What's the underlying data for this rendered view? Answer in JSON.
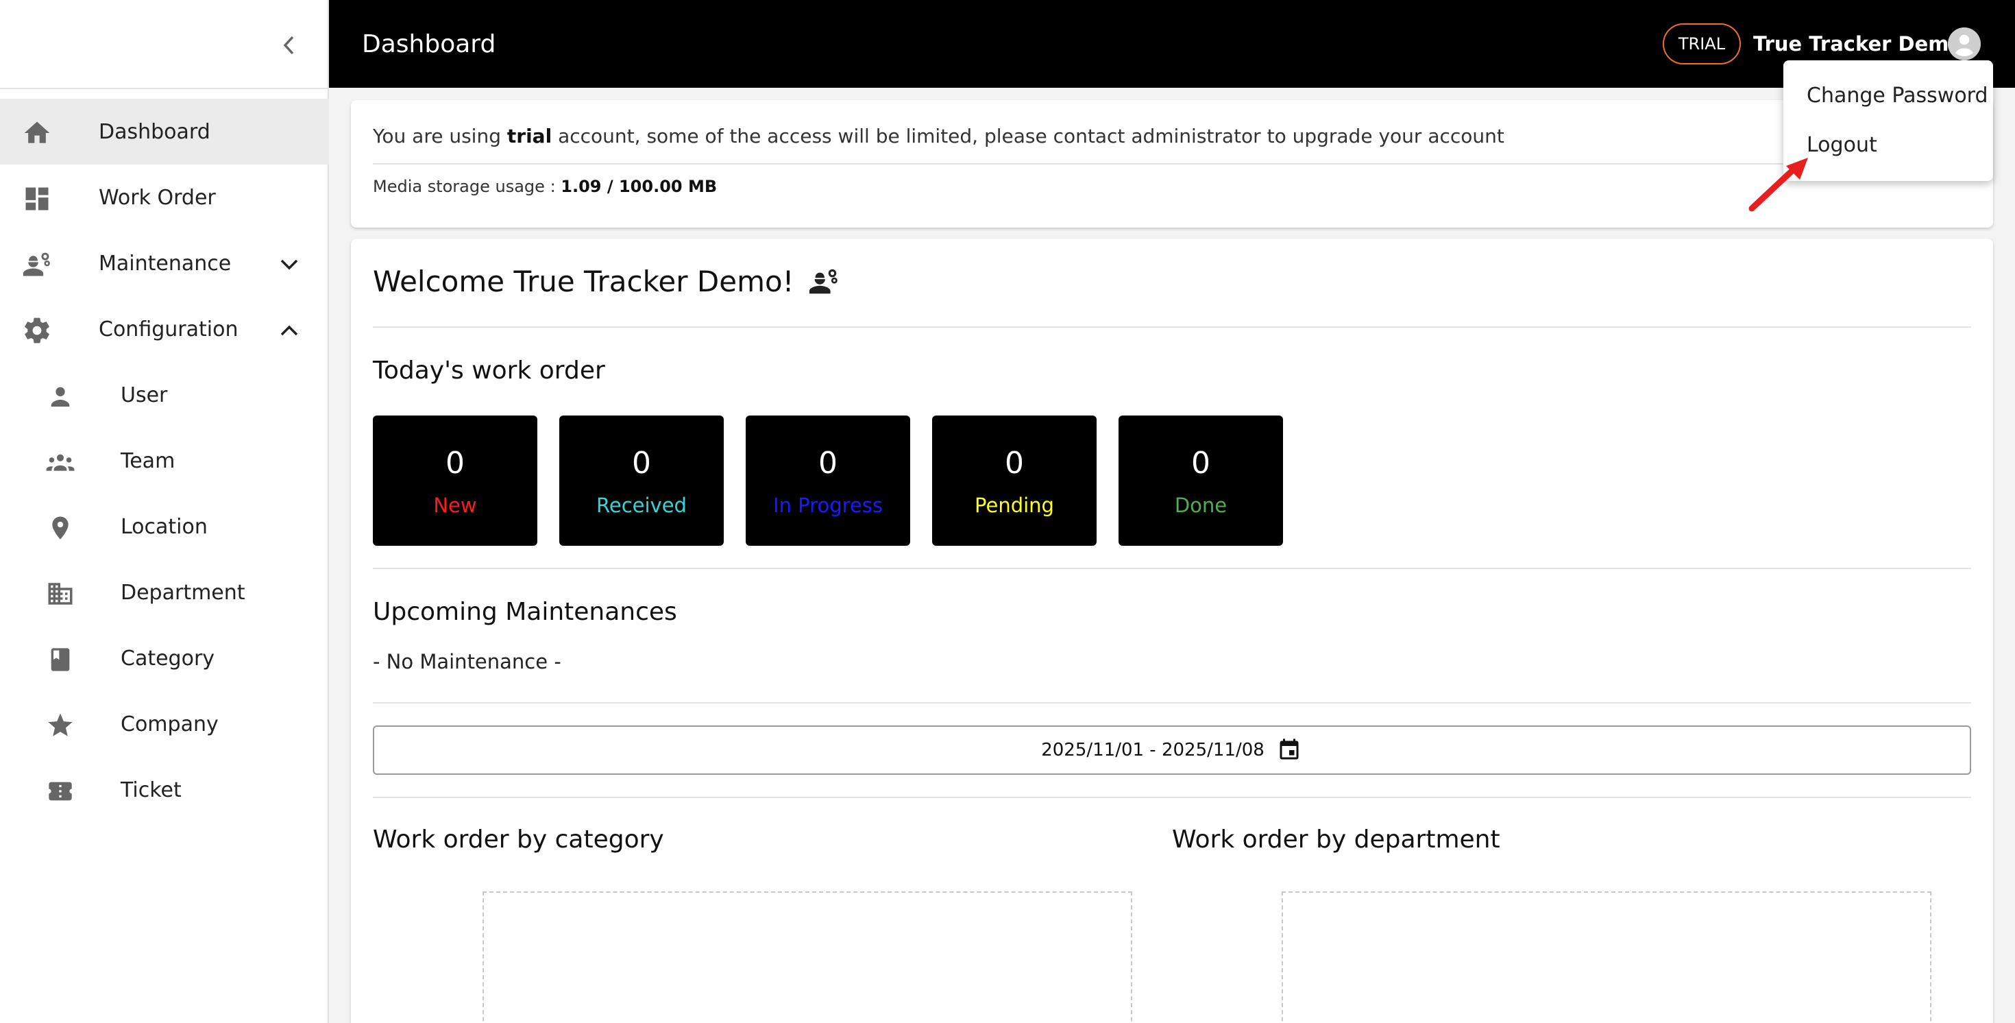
{
  "sidebar": {
    "items": [
      {
        "label": "Dashboard",
        "icon": "home-icon"
      },
      {
        "label": "Work Order",
        "icon": "dashboard-grid-icon"
      },
      {
        "label": "Maintenance",
        "icon": "worker-gear-icon"
      },
      {
        "label": "Configuration",
        "icon": "gear-icon"
      }
    ],
    "sub_items": [
      {
        "label": "User",
        "icon": "person-icon"
      },
      {
        "label": "Team",
        "icon": "group-icon"
      },
      {
        "label": "Location",
        "icon": "location-pin-icon"
      },
      {
        "label": "Department",
        "icon": "building-icon"
      },
      {
        "label": "Category",
        "icon": "book-icon"
      },
      {
        "label": "Company",
        "icon": "star-icon"
      },
      {
        "label": "Ticket",
        "icon": "ticket-icon"
      }
    ]
  },
  "header": {
    "title": "Dashboard",
    "badge": "TRIAL",
    "user_name": "True Tracker Demo"
  },
  "user_menu": {
    "items": [
      "Change Password",
      "Logout"
    ]
  },
  "notice": {
    "prefix": "You are using ",
    "account_type": "trial",
    "suffix": " account, some of the access will be limited, please contact administrator to upgrade your account",
    "storage_label": "Media storage usage : ",
    "storage_value": "1.09 / 100.00 MB"
  },
  "main": {
    "welcome": "Welcome True Tracker Demo!",
    "today_title": "Today's work order",
    "stats": [
      {
        "count": "0",
        "label": "New",
        "color": "#ff1a1a"
      },
      {
        "count": "0",
        "label": "Received",
        "color": "#33d6d6"
      },
      {
        "count": "0",
        "label": "In Progress",
        "color": "#1a1aff"
      },
      {
        "count": "0",
        "label": "Pending",
        "color": "#ffff1a"
      },
      {
        "count": "0",
        "label": "Done",
        "color": "#4caf50"
      }
    ],
    "upcoming_title": "Upcoming Maintenances",
    "no_maintenance": "- No Maintenance -",
    "date_range": "2025/11/01 - 2025/11/08",
    "by_category_title": "Work order by category",
    "by_department_title": "Work order by department"
  },
  "colors": {
    "topbar": "#000000",
    "trial_border": "#ef6c2f",
    "annotation_arrow": "#e81e1e"
  }
}
